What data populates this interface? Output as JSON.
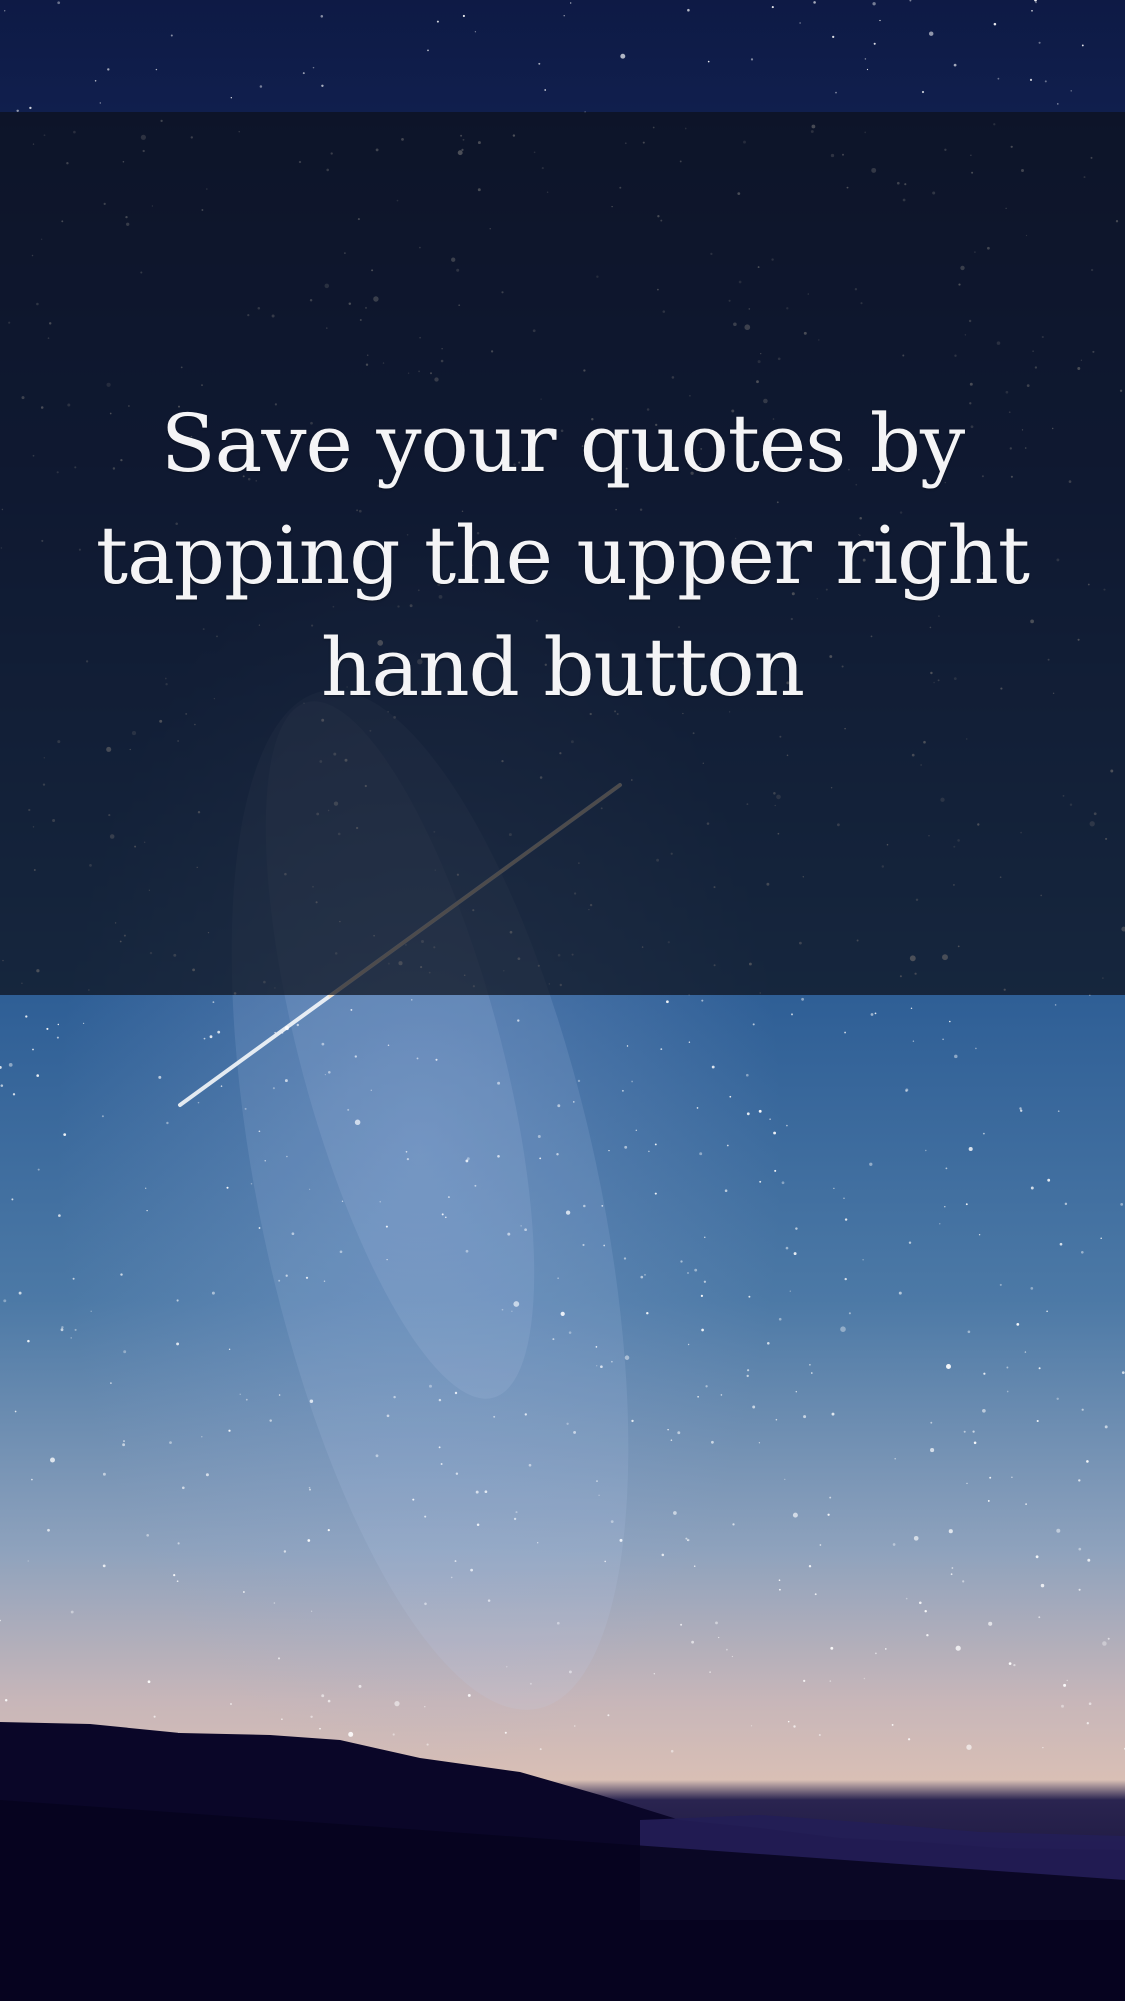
{
  "onboarding": {
    "message": "Save your quotes by tapping the upper right hand button"
  },
  "background": {
    "description_icon": "night-sky-background",
    "colors": {
      "overlay": "#0c101c",
      "sky_top": "#0e1a45",
      "sky_mid": "#2f5f96",
      "horizon": "#d9bfb5",
      "ground": "#060421",
      "text": "#f4f4f6"
    }
  }
}
